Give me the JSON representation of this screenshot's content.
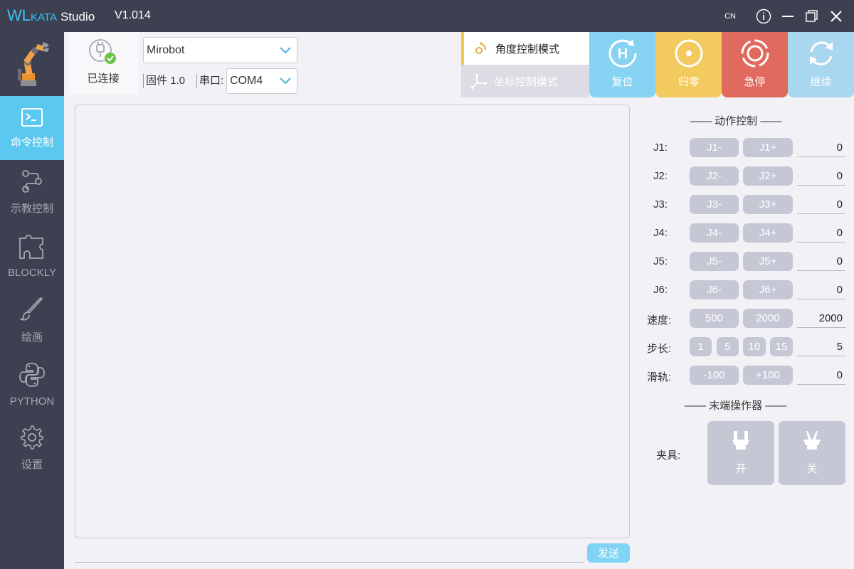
{
  "titlebar": {
    "brand_wl": "WL",
    "brand_kata": "KATA",
    "brand_studio": "Studio",
    "version": "V1.014",
    "lang": "CN"
  },
  "sidebar": {
    "items": [
      {
        "label": "命令控制",
        "icon": "terminal-icon",
        "active": true
      },
      {
        "label": "示教控制",
        "icon": "flow-icon",
        "active": false
      },
      {
        "label": "BLOCKLY",
        "icon": "puzzle-icon",
        "active": false
      },
      {
        "label": "绘画",
        "icon": "brush-icon",
        "active": false
      },
      {
        "label": "PYTHON",
        "icon": "python-icon",
        "active": false
      },
      {
        "label": "设置",
        "icon": "gear-icon",
        "active": false
      }
    ]
  },
  "connection": {
    "status": "已连接",
    "device": "Mirobot",
    "firmware_label": "固件 1.0",
    "port_label": "串口:",
    "port": "COM4"
  },
  "modes": {
    "angle": "角度控制模式",
    "coord": "坐标控制模式"
  },
  "actions": {
    "reset": "复位",
    "zero": "归零",
    "estop": "急停",
    "continue": "继续",
    "colors": {
      "reset": "#86d3f3",
      "zero": "#f2ca5e",
      "estop": "#e06a5e",
      "continue": "#a9d7f0"
    }
  },
  "console": {
    "send": "发送"
  },
  "motion": {
    "title": "—— 动作控制 ——",
    "joints": [
      {
        "label": "J1:",
        "minus": "J1-",
        "plus": "J1+",
        "value": "0"
      },
      {
        "label": "J2:",
        "minus": "J2-",
        "plus": "J2+",
        "value": "0"
      },
      {
        "label": "J3:",
        "minus": "J3-",
        "plus": "J3+",
        "value": "0"
      },
      {
        "label": "J4:",
        "minus": "J4-",
        "plus": "J4+",
        "value": "0"
      },
      {
        "label": "J5:",
        "minus": "J5-",
        "plus": "J5+",
        "value": "0"
      },
      {
        "label": "J6:",
        "minus": "J6-",
        "plus": "J6+",
        "value": "0"
      }
    ],
    "speed": {
      "label": "速度:",
      "opt1": "500",
      "opt2": "2000",
      "value": "2000"
    },
    "step": {
      "label": "步长:",
      "opts": [
        "1",
        "5",
        "10",
        "15"
      ],
      "value": "5"
    },
    "rail": {
      "label": "滑轨:",
      "minus": "-100",
      "plus": "+100",
      "value": "0"
    }
  },
  "effector": {
    "title": "—— 末端操作器 ——",
    "gripper_label": "夹具:",
    "open": "开",
    "close": "关"
  }
}
